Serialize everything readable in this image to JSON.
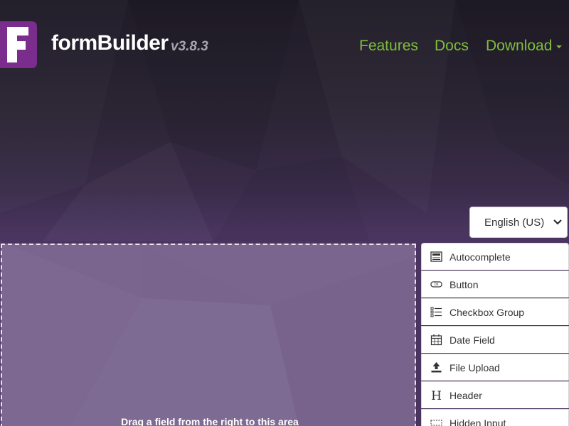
{
  "header": {
    "brand": "formBuilder",
    "version": "v3.8.3",
    "nav": {
      "features": "Features",
      "docs": "Docs",
      "download": "Download"
    }
  },
  "language_select": {
    "selected": "English (US)"
  },
  "stage": {
    "drop_hint": "Drag a field from the right to this area"
  },
  "controls": {
    "items": [
      {
        "label": "Autocomplete",
        "icon": "autocomplete-icon"
      },
      {
        "label": "Button",
        "icon": "button-icon"
      },
      {
        "label": "Checkbox Group",
        "icon": "checkbox-group-icon"
      },
      {
        "label": "Date Field",
        "icon": "calendar-icon"
      },
      {
        "label": "File Upload",
        "icon": "upload-icon"
      },
      {
        "label": "Header",
        "icon": "header-icon"
      },
      {
        "label": "Hidden Input",
        "icon": "hidden-input-icon"
      }
    ]
  },
  "colors": {
    "nav_link": "#7fbf3b",
    "logo": "#7b2d8e",
    "brand_text": "#ffffff",
    "version_text": "#a9a5ae"
  }
}
